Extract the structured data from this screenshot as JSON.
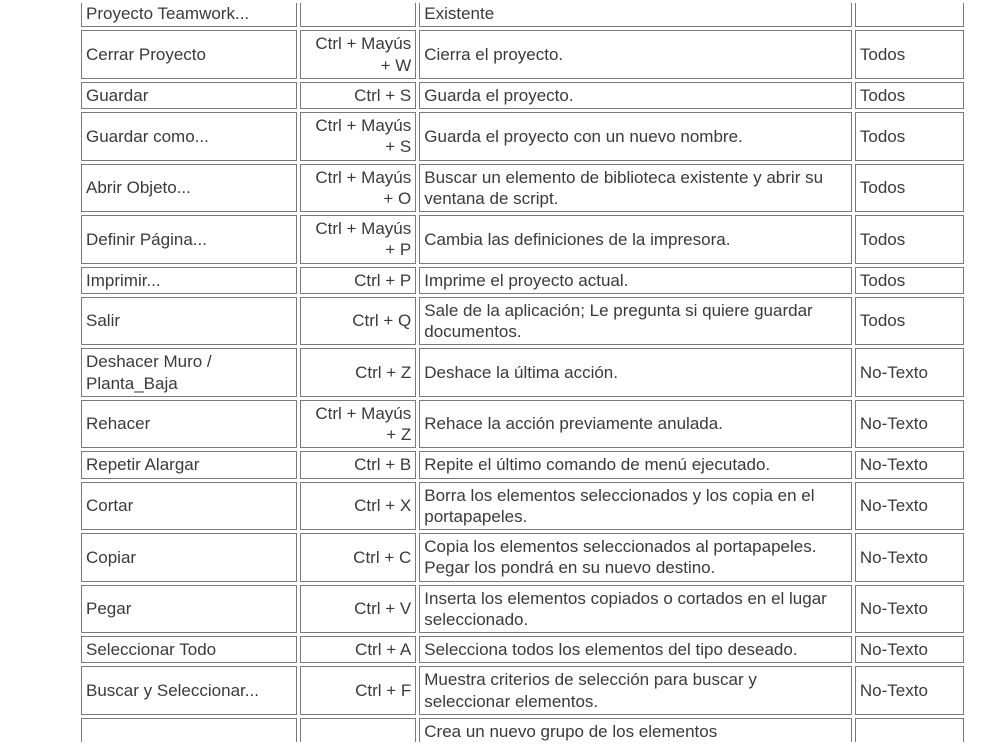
{
  "rows": [
    {
      "cmd": "Proyecto Teamwork...",
      "key": "",
      "desc": "Existente",
      "scope": ""
    },
    {
      "cmd": "Cerrar Proyecto",
      "key": "Ctrl + Mayús + W",
      "desc": "Cierra el proyecto.",
      "scope": "Todos"
    },
    {
      "cmd": "Guardar",
      "key": "Ctrl + S",
      "desc": "Guarda el proyecto.",
      "scope": "Todos"
    },
    {
      "cmd": "Guardar como...",
      "key": "Ctrl + Mayús + S",
      "desc": "Guarda el proyecto con un nuevo nombre.",
      "scope": "Todos"
    },
    {
      "cmd": "Abrir Objeto...",
      "key": "Ctrl + Mayús + O",
      "desc": "Buscar un elemento de biblioteca existente y abrir su ventana de script.",
      "scope": "Todos"
    },
    {
      "cmd": "Definir Página...",
      "key": "Ctrl + Mayús + P",
      "desc": "Cambia las definiciones de la impresora.",
      "scope": "Todos"
    },
    {
      "cmd": "Imprimir...",
      "key": "Ctrl + P",
      "desc": "Imprime el proyecto actual.",
      "scope": "Todos"
    },
    {
      "cmd": "Salir",
      "key": "Ctrl + Q",
      "desc": "Sale de la aplicación; Le pregunta si quiere guardar documentos.",
      "scope": "Todos"
    },
    {
      "cmd": "Deshacer Muro / Planta_Baja",
      "key": "Ctrl + Z",
      "desc": "Deshace la última acción.",
      "scope": "No-Texto"
    },
    {
      "cmd": "Rehacer",
      "key": "Ctrl + Mayús + Z",
      "desc": "Rehace la acción previamente anulada.",
      "scope": "No-Texto"
    },
    {
      "cmd": "Repetir Alargar",
      "key": "Ctrl + B",
      "desc": "Repite el último comando de menú ejecutado.",
      "scope": "No-Texto"
    },
    {
      "cmd": "Cortar",
      "key": "Ctrl + X",
      "desc": "Borra los elementos seleccionados y los copia en el portapapeles.",
      "scope": "No-Texto"
    },
    {
      "cmd": "Copiar",
      "key": "Ctrl + C",
      "desc": "Copia los elementos seleccionados al portapapeles. Pegar los pondrá en su nuevo destino.",
      "scope": "No-Texto"
    },
    {
      "cmd": "Pegar",
      "key": "Ctrl + V",
      "desc": "Inserta los elementos copiados o cortados en el lugar seleccionado.",
      "scope": "No-Texto"
    },
    {
      "cmd": "Seleccionar Todo",
      "key": "Ctrl + A",
      "desc": "Selecciona todos los elementos del tipo deseado.",
      "scope": "No-Texto"
    },
    {
      "cmd": "Buscar y Seleccionar...",
      "key": "Ctrl + F",
      "desc": "Muestra criterios de selección para buscar y seleccionar elementos.",
      "scope": "No-Texto"
    },
    {
      "cmd": "",
      "key": "",
      "desc": "Crea un nuevo grupo de los elementos",
      "scope": ""
    }
  ]
}
